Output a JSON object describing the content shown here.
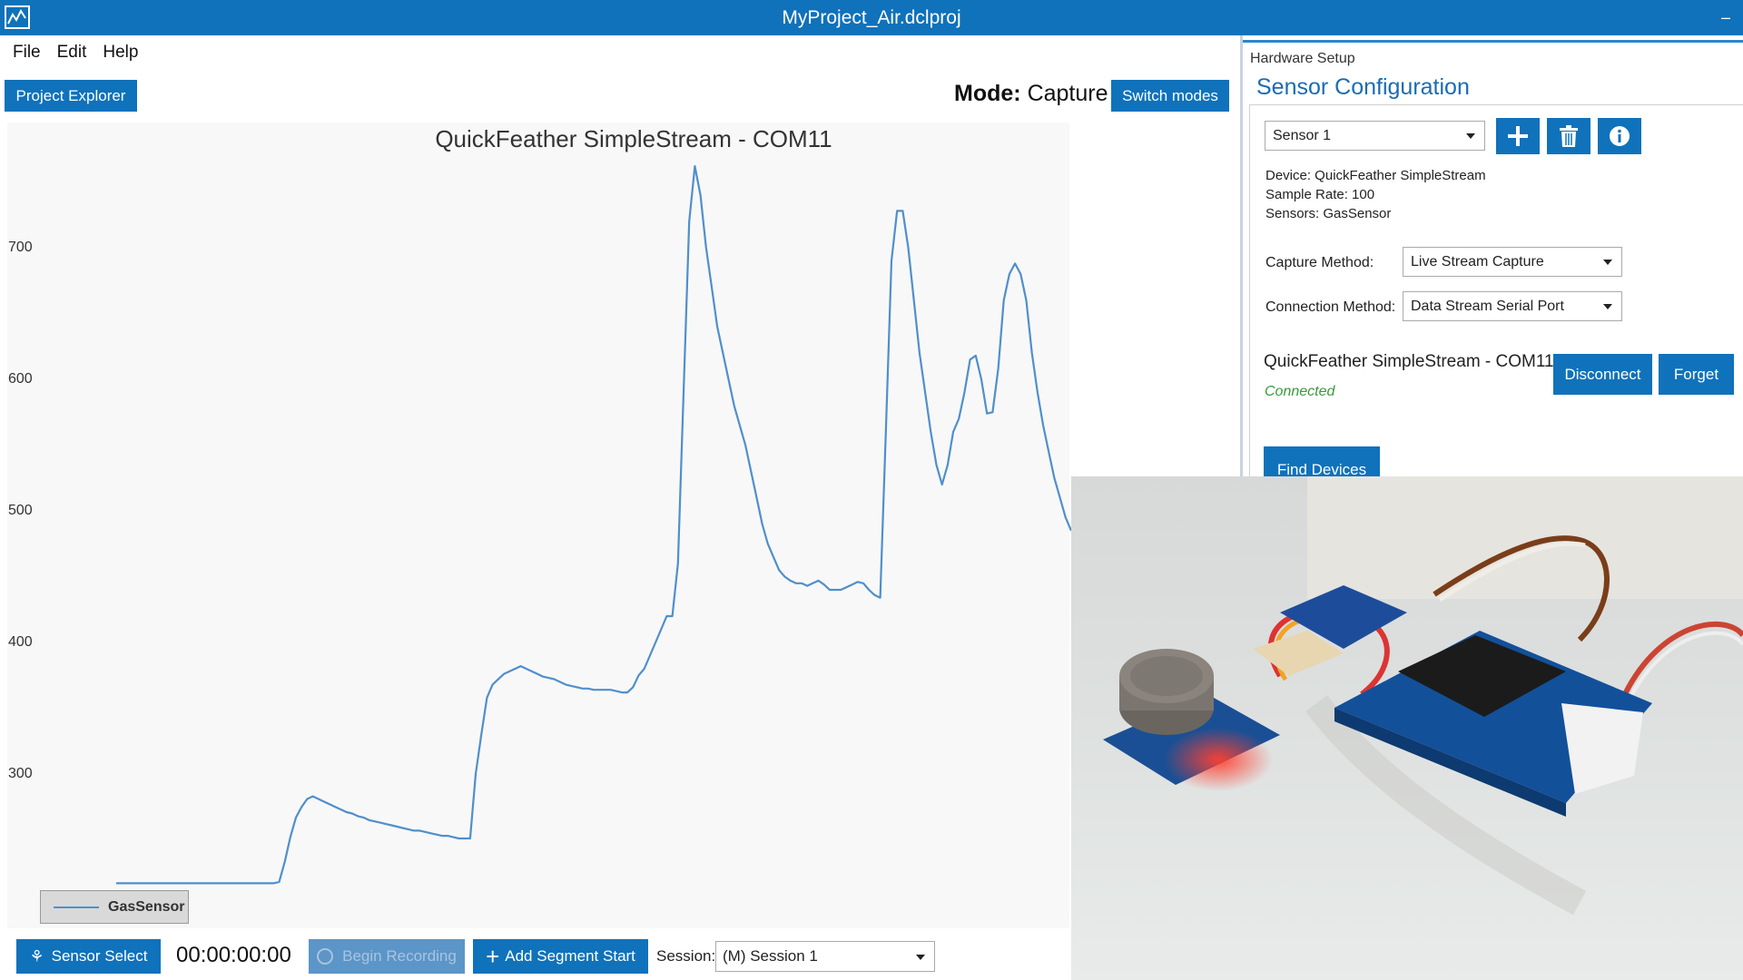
{
  "window": {
    "title": "MyProject_Air.dclproj",
    "minimize_glyph": "–"
  },
  "menu": [
    {
      "label": "File"
    },
    {
      "label": "Edit"
    },
    {
      "label": "Help"
    }
  ],
  "toolbar": {
    "project_explorer": "Project Explorer",
    "mode_prefix": "Mode:",
    "mode_value": "Capture",
    "switch_modes": "Switch modes"
  },
  "chart_data": {
    "type": "line",
    "title": "QuickFeather SimpleStream - COM11",
    "yticks": [
      700,
      600,
      500,
      400,
      300
    ],
    "ylim": [
      180,
      770
    ],
    "legend": "GasSensor",
    "legend_placement": "bottom-left",
    "grid": false,
    "series": [
      {
        "name": "GasSensor",
        "color": "#4f8fcc",
        "y": [
          217,
          217,
          217,
          217,
          217,
          217,
          217,
          217,
          217,
          217,
          217,
          217,
          217,
          217,
          217,
          217,
          217,
          217,
          217,
          217,
          217,
          217,
          217,
          217,
          217,
          217,
          217,
          217,
          217,
          218,
          233,
          252,
          267,
          275,
          281,
          283,
          281,
          279,
          277,
          275,
          273,
          271,
          270,
          268,
          267,
          265,
          264,
          263,
          262,
          261,
          260,
          259,
          258,
          257,
          257,
          256,
          255,
          254,
          253,
          253,
          252,
          251,
          251,
          251,
          300,
          330,
          358,
          368,
          372,
          376,
          378,
          380,
          382,
          380,
          378,
          376,
          374,
          373,
          372,
          370,
          368,
          367,
          366,
          365,
          365,
          364,
          364,
          364,
          364,
          363,
          362,
          362,
          366,
          375,
          380,
          390,
          400,
          410,
          420,
          420,
          460,
          590,
          720,
          762,
          740,
          700,
          670,
          640,
          620,
          600,
          580,
          565,
          550,
          530,
          510,
          490,
          475,
          465,
          455,
          450,
          447,
          445,
          445,
          443,
          445,
          447,
          444,
          440,
          440,
          440,
          442,
          444,
          446,
          445,
          440,
          436,
          434,
          560,
          690,
          728,
          728,
          700,
          660,
          620,
          590,
          560,
          535,
          520,
          535,
          560,
          570,
          590,
          615,
          618,
          600,
          574,
          575,
          608,
          660,
          680,
          688,
          680,
          660,
          620,
          590,
          565,
          545,
          525,
          510,
          495,
          485
        ]
      }
    ]
  },
  "bottom_bar": {
    "sensor_select": "Sensor Select",
    "timer": "00:00:00:00",
    "begin_recording": "Begin Recording",
    "add_segment": "Add Segment Start",
    "session_label": "Session:",
    "session_value": "(M) Session 1"
  },
  "right_panel": {
    "section_label": "Hardware Setup",
    "title": "Sensor Configuration",
    "sensor_select": "Sensor 1",
    "device": "Device: QuickFeather SimpleStream",
    "sample_rate": "Sample Rate: 100",
    "sensors": "Sensors: GasSensor",
    "capture_method_label": "Capture Method:",
    "capture_method_value": "Live Stream Capture",
    "connection_method_label": "Connection Method:",
    "connection_method_value": "Data Stream Serial Port",
    "device_name": "QuickFeather SimpleStream - COM11",
    "status": "Connected",
    "disconnect": "Disconnect",
    "forget": "Forget",
    "find_devices": "Find Devices"
  }
}
